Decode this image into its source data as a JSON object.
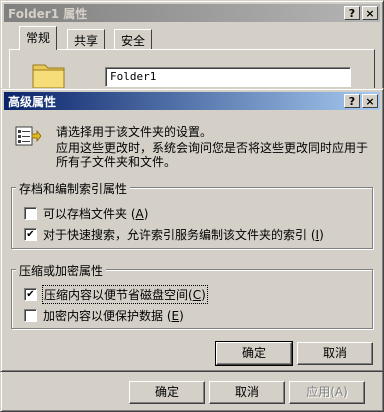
{
  "back_window": {
    "title": "Folder1 属性",
    "title_buttons": [
      "?",
      "×"
    ],
    "tabs": [
      "常规",
      "共享",
      "安全"
    ],
    "folder_name": "Folder1",
    "buttons": {
      "ok": "确定",
      "cancel": "取消",
      "apply": "应用(A)"
    }
  },
  "dialog": {
    "title": "高级属性",
    "title_buttons": [
      "?",
      "×"
    ],
    "intro_line1": "请选择用于该文件夹的设置。",
    "intro_line2": "应用这些更改时，系统会询问您是否将这些更改同时应用于",
    "intro_line3": "所有子文件夹和文件。",
    "archive_group": {
      "title": "存档和编制索引属性",
      "options": [
        {
          "label": "可以存档文件夹",
          "key": "A",
          "checked": false
        },
        {
          "label": "对于快速搜索，允许索引服务编制该文件夹的索引",
          "key": "I",
          "checked": true
        }
      ]
    },
    "compress_group": {
      "title": "压缩或加密属性",
      "options": [
        {
          "label": "压缩内容以便节省磁盘空间",
          "key": "C",
          "checked": true
        },
        {
          "label": "加密内容以便保护数据",
          "key": "E",
          "checked": false
        }
      ]
    },
    "buttons": {
      "ok": "确定",
      "cancel": "取消"
    }
  },
  "icons": {
    "folder": "folder-icon",
    "properties": "properties-icon"
  },
  "colors": {
    "active_title": "#0a246a",
    "inactive_title": "#808080",
    "face": "#d4d0c8"
  }
}
